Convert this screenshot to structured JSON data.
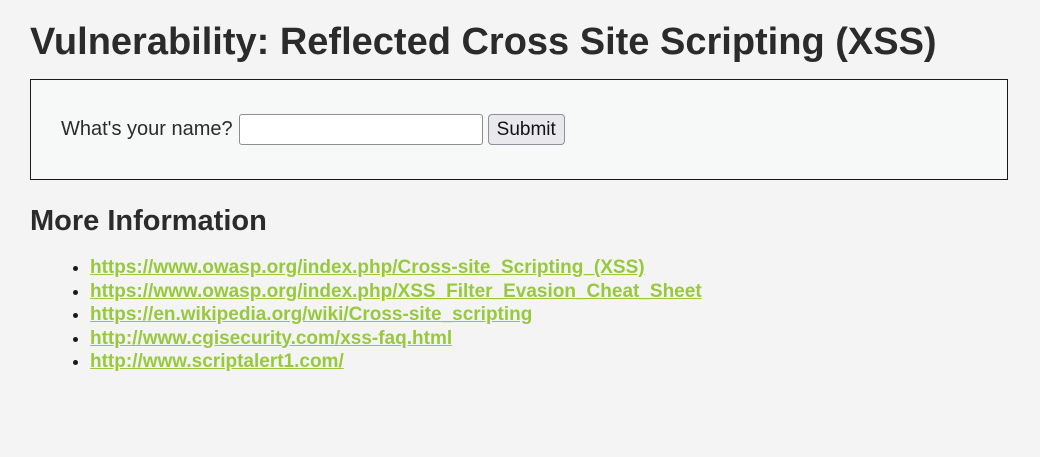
{
  "header": {
    "title": "Vulnerability: Reflected Cross Site Scripting (XSS)"
  },
  "form": {
    "label": "What's your name?",
    "input_value": "",
    "submit_label": "Submit"
  },
  "more_info": {
    "heading": "More Information",
    "links": [
      {
        "text": "https://www.owasp.org/index.php/Cross-site_Scripting_(XSS)"
      },
      {
        "text": "https://www.owasp.org/index.php/XSS_Filter_Evasion_Cheat_Sheet"
      },
      {
        "text": "https://en.wikipedia.org/wiki/Cross-site_scripting"
      },
      {
        "text": "http://www.cgisecurity.com/xss-faq.html"
      },
      {
        "text": "http://www.scriptalert1.com/"
      }
    ]
  },
  "colors": {
    "link": "#98c93c",
    "background": "#f4f4f4",
    "box_background": "#f7f8f8"
  }
}
